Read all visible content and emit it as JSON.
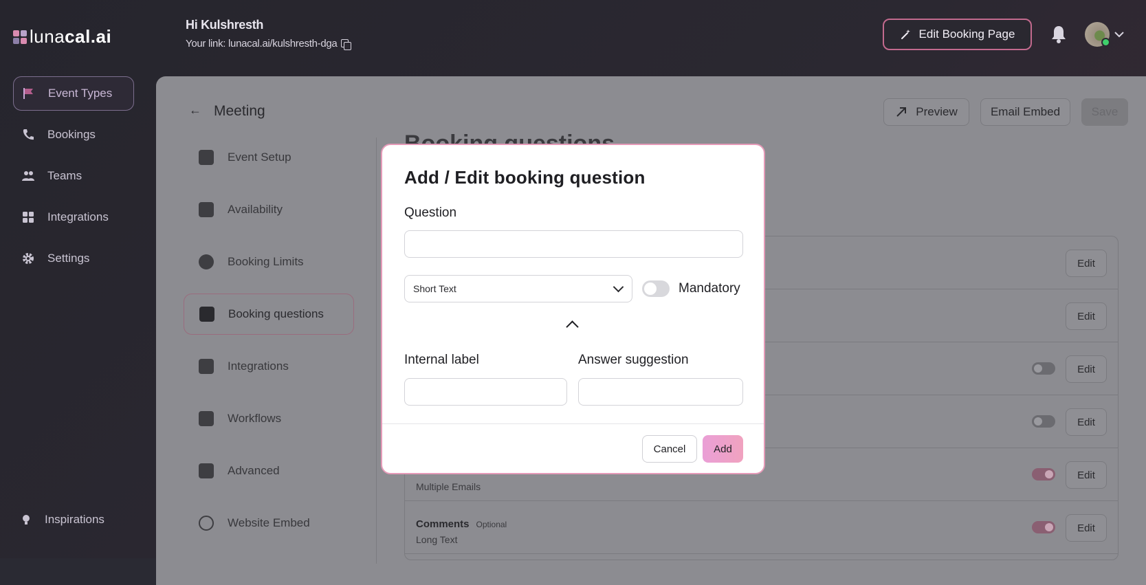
{
  "colors": {
    "accent": "#e59ab8",
    "add_button": "#ee9fcb",
    "app_bg": "#2a2830",
    "overlay_panel": "#8c8c91"
  },
  "header": {
    "logo_light": "luna",
    "logo_bold": "cal.ai",
    "greeting": "Hi Kulshresth",
    "link_text": "Your link: lunacal.ai/kulshresth-dga",
    "edit_booking_label": "Edit Booking Page"
  },
  "sidebar": {
    "items": [
      {
        "label": "Event Types",
        "icon": "flag-icon"
      },
      {
        "label": "Bookings",
        "icon": "phone-icon"
      },
      {
        "label": "Teams",
        "icon": "users-icon"
      },
      {
        "label": "Integrations",
        "icon": "grid-icon"
      },
      {
        "label": "Settings",
        "icon": "gear-icon"
      }
    ],
    "bottom_label": "Inspirations"
  },
  "event": {
    "title": "Meeting",
    "preview_label": "Preview",
    "email_embed_label": "Email Embed",
    "save_label": "Save",
    "tabs": [
      {
        "label": "Event Setup"
      },
      {
        "label": "Availability"
      },
      {
        "label": "Booking Limits"
      },
      {
        "label": "Booking questions"
      },
      {
        "label": "Integrations"
      },
      {
        "label": "Workflows"
      },
      {
        "label": "Advanced"
      },
      {
        "label": "Website Embed"
      }
    ],
    "section_title": "Booking questions"
  },
  "questions": {
    "edit_label": "Edit",
    "rows": [
      {
        "name": "",
        "type": "",
        "badge": ""
      },
      {
        "name": "",
        "type": "",
        "badge": ""
      },
      {
        "name": "",
        "type": "",
        "badge": ""
      },
      {
        "name": "",
        "type": "",
        "badge": ""
      },
      {
        "name": "",
        "type": "Multiple Emails",
        "badge": ""
      },
      {
        "name": "Comments",
        "type": "Long Text",
        "badge": "Optional"
      }
    ],
    "toggles": [
      null,
      null,
      false,
      false,
      true,
      true
    ]
  },
  "modal": {
    "title": "Add / Edit booking question",
    "question_label": "Question",
    "question_value": "",
    "type_selected": "Short Text",
    "mandatory_label": "Mandatory",
    "mandatory_on": false,
    "internal_label": "Internal label",
    "internal_value": "",
    "answer_label": "Answer suggestion",
    "answer_value": "",
    "cancel_label": "Cancel",
    "add_label": "Add"
  }
}
